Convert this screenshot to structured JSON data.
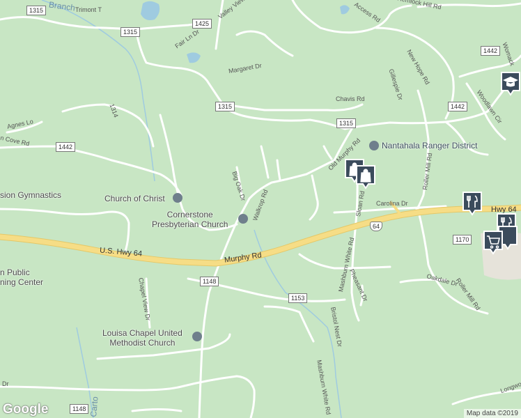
{
  "roads": {
    "us_hwy_64": "U.S. Hwy 64",
    "murphy_rd": "Murphy Rd",
    "hwy_64_east": "Hwy 64",
    "branch": "Branch",
    "trimont": "Trimont T",
    "valley_view_trail": "Valley View Trail",
    "fair_ln_dr": "Fair Ln Dr",
    "margaret_dr": "Margaret Dr",
    "chavis_rd": "Chavis Rd",
    "old_murphy_rd": "Old Murphy Rd",
    "big_oak_dr": "Big Oak Dr",
    "walkrop_rd": "Walkrop Rd",
    "sloan_rd": "Sloan Rd",
    "carolina_dr": "Carolina Dr",
    "mashburn_white_rd": "Mashburn White Rd",
    "mashburn_white_rd_south": "Mashburn White Rd",
    "pheasant_dr": "Pheasant Dr",
    "bristol_nest_dr": "Bristol Nest Dr",
    "chapel_view_dr": "Chapel View Dr",
    "agnes_lo": "Agnes Lo",
    "cove_rd": "n Cove Rd",
    "access_rd": "Access Rd",
    "hemlock_hill_rd": "Hemlock Hill Rd",
    "new_hope_rd": "New Hope Rd",
    "gillespie_dr": "Gillespie Dr",
    "woodlawn_cir": "Woodlawn Cir",
    "roller_mill_rd": "Roller Mill Rd",
    "roller_mill_rd_south": "Roller Mill Rd",
    "oakdale_dr": "Oakdale Dr",
    "longwood": "Longwo",
    "womack": "Womack",
    "cartoogechaye": "Carto",
    "dr_left": "Dr",
    "road_1314": "1314"
  },
  "shields": {
    "s1315_top": "1315",
    "s1425": "1425",
    "s1315_mid": "1315",
    "s1315_right": "1315",
    "s1442_left": "1442",
    "s1442_right": "1442",
    "s1442_top": "1442",
    "s1148": "1148",
    "s1148_bottom": "1148",
    "s1153": "1153",
    "s1170": "1170",
    "us64": "64"
  },
  "pois": {
    "nantahala": "Nantahala Ranger District",
    "church_of_christ": "Church of Christ",
    "cornerstone": "Cornerstone\nPresbyterian Church",
    "louisa": "Louisa Chapel United\nMethodist Church",
    "gymnastics": "sion Gymnastics",
    "public_center": "n Public\nning Center"
  },
  "branding": {
    "logo": "Google",
    "attribution": "Map data ©2019"
  },
  "colors": {
    "land": "#c8e6c4",
    "road": "#ffffff",
    "highway": "#f6dd86",
    "water": "#9fcbe0",
    "pin": "#3b4b5c"
  }
}
